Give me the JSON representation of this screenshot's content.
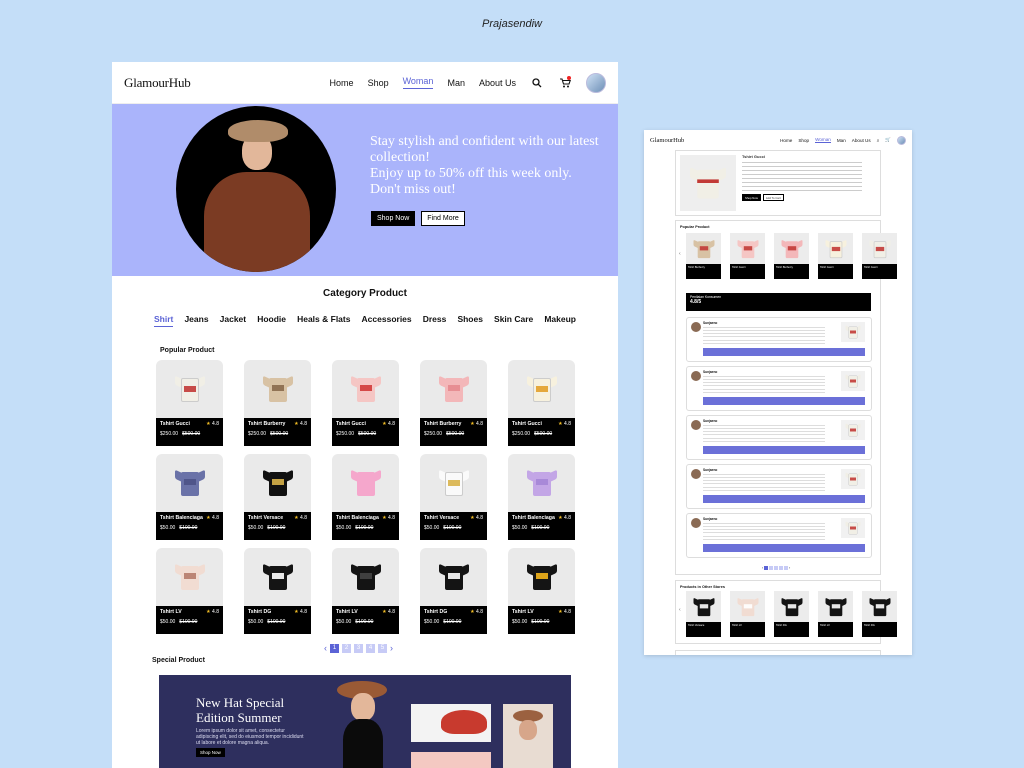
{
  "author": "Prajasendiw",
  "brand": "GlamourHub",
  "nav": {
    "links": [
      {
        "label": "Home",
        "active": false
      },
      {
        "label": "Shop",
        "active": false
      },
      {
        "label": "Woman",
        "active": true
      },
      {
        "label": "Man",
        "active": false
      },
      {
        "label": "About Us",
        "active": false
      }
    ],
    "search_icon": "search-icon",
    "cart_icon": "cart-icon"
  },
  "hero": {
    "headline_1": "Stay stylish and confident with our latest collection!",
    "headline_2": "Enjoy up to 50% off this week only. Don't miss out!",
    "shop_button": "Shop Now",
    "find_button": "Find More",
    "background": "#aab4fb"
  },
  "category": {
    "title": "Category Product",
    "items": [
      {
        "label": "Shirt",
        "active": true
      },
      {
        "label": "Jeans",
        "active": false
      },
      {
        "label": "Jacket",
        "active": false
      },
      {
        "label": "Hoodie",
        "active": false
      },
      {
        "label": "Heals & Flats",
        "active": false
      },
      {
        "label": "Accessories",
        "active": false
      },
      {
        "label": "Dress",
        "active": false
      },
      {
        "label": "Shoes",
        "active": false
      },
      {
        "label": "Skin Care",
        "active": false
      },
      {
        "label": "Makeup",
        "active": false
      }
    ]
  },
  "popular": {
    "title": "Popular Product",
    "products": [
      {
        "name": "Tshirt Gucci",
        "price": "$250.00",
        "old_price": "$500.00",
        "rating": "4.8",
        "color": "#f1efe6",
        "accent": "#c23a36"
      },
      {
        "name": "Tshirt Burberry",
        "price": "$250.00",
        "old_price": "$500.00",
        "rating": "4.8",
        "color": "#d8c2a4",
        "accent": "#8a6a4c"
      },
      {
        "name": "Tshirt Gucci",
        "price": "$250.00",
        "old_price": "$500.00",
        "rating": "4.8",
        "color": "#f5c6c4",
        "accent": "#d23a3a"
      },
      {
        "name": "Tshirt Burberry",
        "price": "$250.00",
        "old_price": "$500.00",
        "rating": "4.8",
        "color": "#f3b7b9",
        "accent": "#e58a8f"
      },
      {
        "name": "Tshirt Gucci",
        "price": "$250.00",
        "old_price": "$500.00",
        "rating": "4.8",
        "color": "#f7f1de",
        "accent": "#e2a02a"
      },
      {
        "name": "Tshirt Balenciaga",
        "price": "$50.00",
        "old_price": "$100.00",
        "rating": "4.8",
        "color": "#6a72a8",
        "accent": "#4c5286"
      },
      {
        "name": "Tshirt Versace",
        "price": "$50.00",
        "old_price": "$100.00",
        "rating": "4.8",
        "color": "#111111",
        "accent": "#d8b34a"
      },
      {
        "name": "Tshirt Balenciaga",
        "price": "$50.00",
        "old_price": "$100.00",
        "rating": "4.8",
        "color": "#f5a7cc",
        "accent": "#f5a7cc"
      },
      {
        "name": "Tshirt Versace",
        "price": "$50.00",
        "old_price": "$100.00",
        "rating": "4.8",
        "color": "#fafafa",
        "accent": "#d8b34a"
      },
      {
        "name": "Tshirt Balenciaga",
        "price": "$50.00",
        "old_price": "$100.00",
        "rating": "4.8",
        "color": "#c3a6e6",
        "accent": "#a586d6"
      },
      {
        "name": "Tshirt LV",
        "price": "$50.00",
        "old_price": "$100.00",
        "rating": "4.8",
        "color": "#f1dcd2",
        "accent": "#b57b6a"
      },
      {
        "name": "Tshirt DG",
        "price": "$50.00",
        "old_price": "$100.00",
        "rating": "4.8",
        "color": "#141414",
        "accent": "#ffffff"
      },
      {
        "name": "Tshirt LV",
        "price": "$50.00",
        "old_price": "$100.00",
        "rating": "4.8",
        "color": "#141414",
        "accent": "#444444"
      },
      {
        "name": "Tshirt DG",
        "price": "$50.00",
        "old_price": "$100.00",
        "rating": "4.8",
        "color": "#141414",
        "accent": "#ffffff"
      },
      {
        "name": "Tshirt LV",
        "price": "$50.00",
        "old_price": "$100.00",
        "rating": "4.8",
        "color": "#141414",
        "accent": "#f2b21a"
      }
    ]
  },
  "pager": {
    "pages": [
      "1",
      "2",
      "3",
      "4",
      "5"
    ],
    "current": "1"
  },
  "special": {
    "title": "Special Product",
    "heading_1": "New Hat Special",
    "heading_2": "Edition Summer",
    "body": "Lorem ipsum dolor sit amet, consectetur adipiscing elit, sed do eiusmod tempor incididunt ut labore et dolore magna aliqua.",
    "button": "Shop Now",
    "background": "#2e2f5e"
  },
  "second_page": {
    "brand": "GlamourHub",
    "nav": [
      "Home",
      "Shop",
      "Woman",
      "Man",
      "About Us"
    ],
    "active_nav": "Woman",
    "detail": {
      "name": "Tshirt Gucci",
      "buy_button": "Shop Now",
      "cart_button": "Add To Cart"
    },
    "popular_title": "Popular Product",
    "popular_cards": [
      "Tshirt Burberry",
      "Tshirt Gucci",
      "Tshirt Burberry",
      "Tshirt Gucci",
      "Tshirt Gucci"
    ],
    "rating_label": "Penilaian Konsumen",
    "rating_value": "4.8/5",
    "reviewer": "Sunjaeno",
    "reviews_count": 5,
    "other_title": "Products in Other Stores",
    "other_cards": [
      "Tshirt Versace",
      "Tshirt LV",
      "Tshirt DG",
      "Tshirt LV",
      "Tshirt DG"
    ]
  }
}
